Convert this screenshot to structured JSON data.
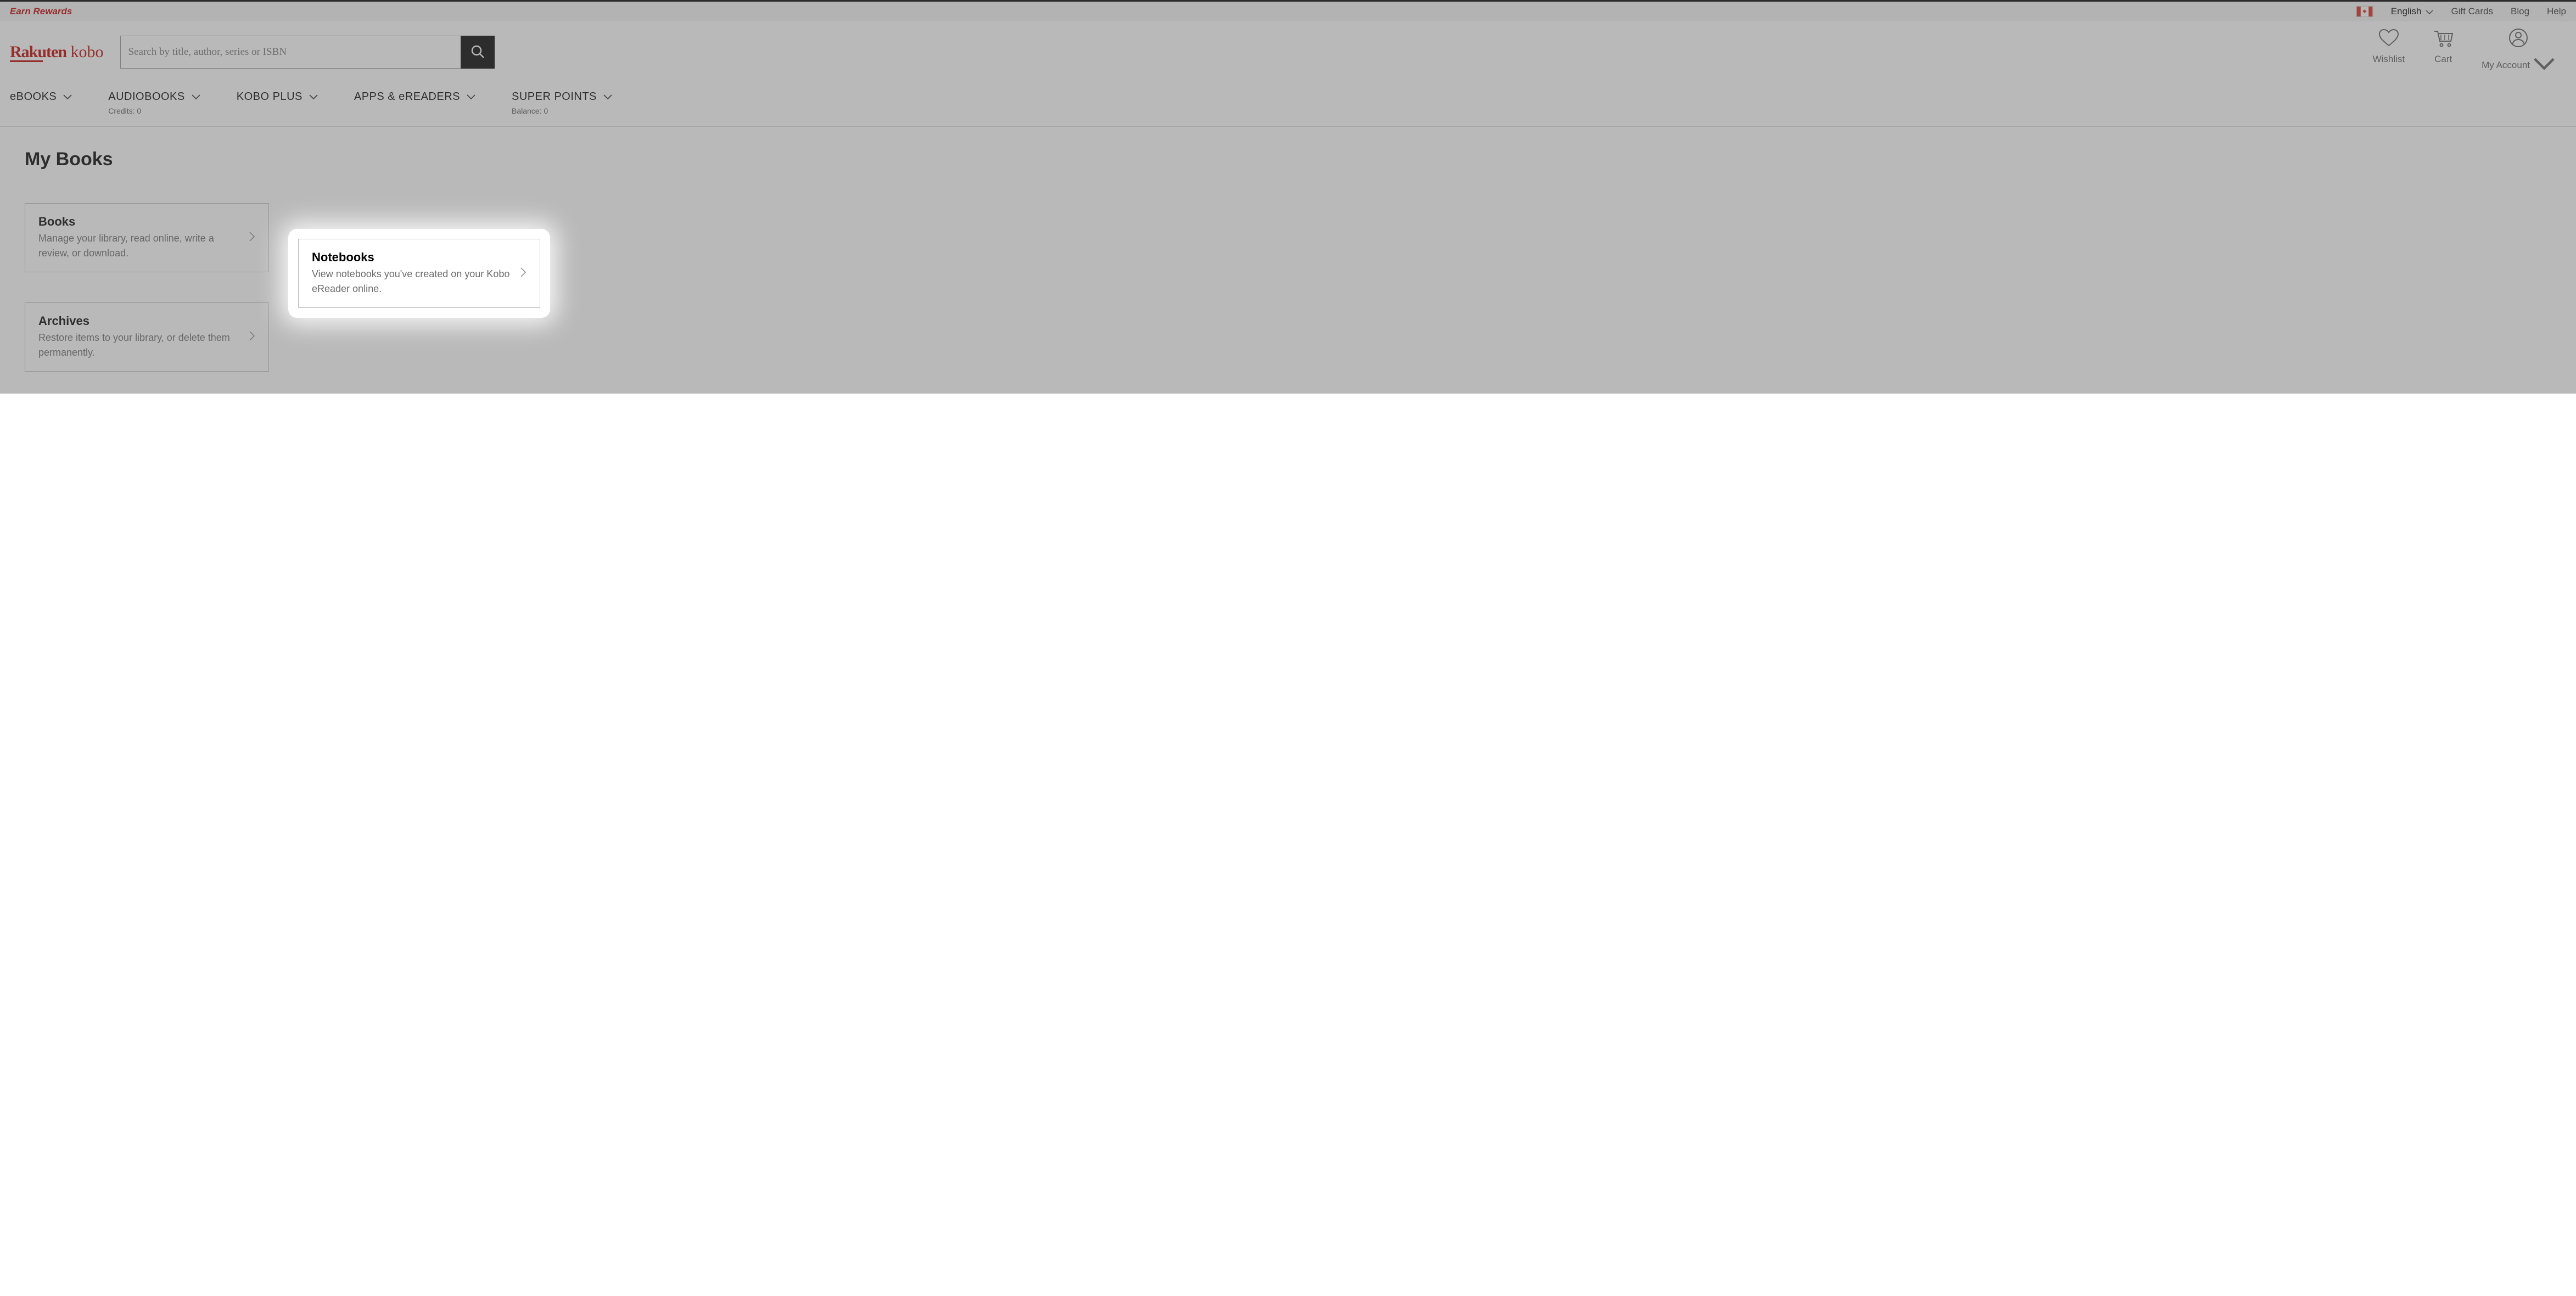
{
  "topbar": {
    "earn_rewards": "Earn Rewards",
    "language": "English",
    "gift_cards": "Gift Cards",
    "blog": "Blog",
    "help": "Help"
  },
  "header": {
    "logo_rakuten": "Rakuten",
    "logo_kobo": "kobo",
    "search_placeholder": "Search by title, author, series or ISBN",
    "wishlist": "Wishlist",
    "cart": "Cart",
    "account": "My Account"
  },
  "nav": {
    "ebooks": "eBOOKS",
    "audiobooks": "AUDIOBOOKS",
    "audiobooks_sub": "Credits: 0",
    "kobo_plus": "KOBO PLUS",
    "apps": "APPS & eREADERS",
    "super_points": "SUPER POINTS",
    "super_points_sub": "Balance: 0"
  },
  "page": {
    "title": "My Books"
  },
  "cards": {
    "books": {
      "title": "Books",
      "desc": "Manage your library, read online, write a review, or download."
    },
    "notebooks": {
      "title": "Notebooks",
      "desc": "View notebooks you've created on your Kobo eReader online."
    },
    "archives": {
      "title": "Archives",
      "desc": "Restore items to your library, or delete them permanently."
    }
  }
}
